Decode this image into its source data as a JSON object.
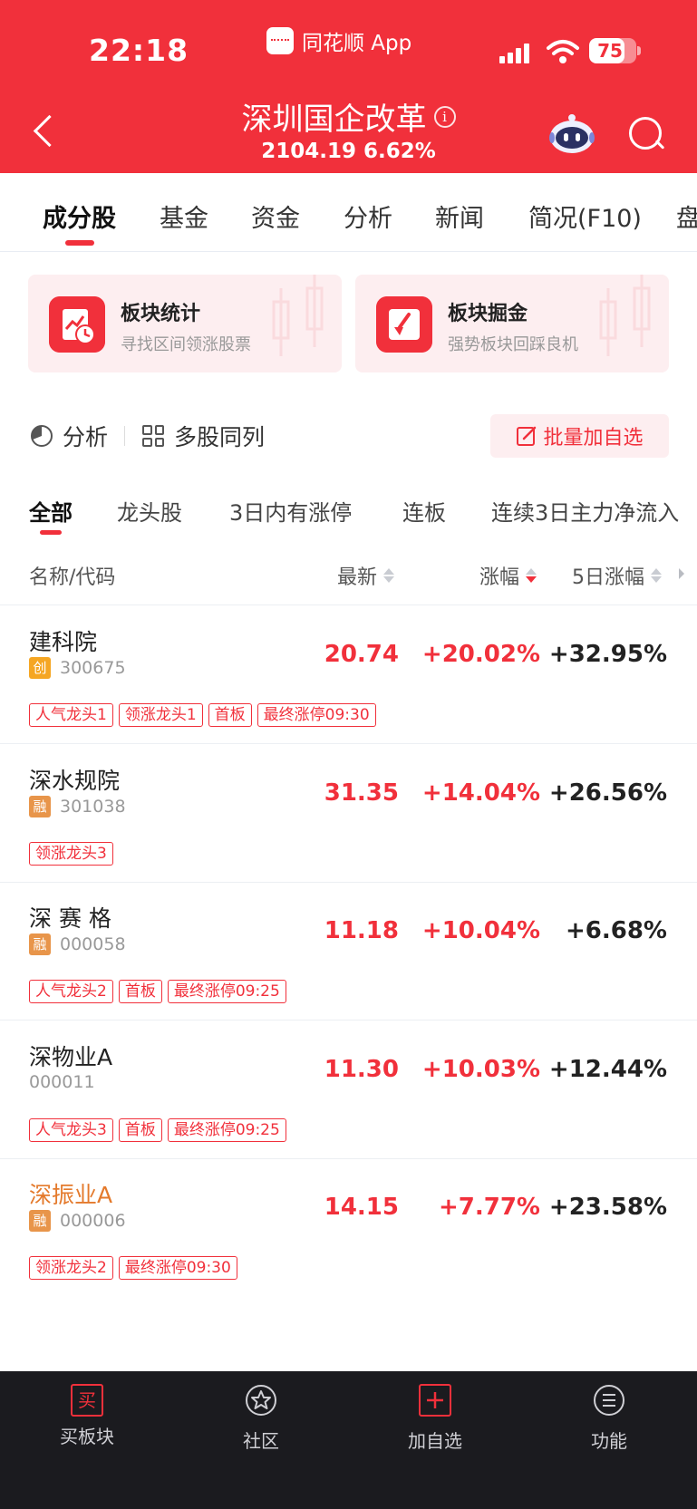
{
  "status": {
    "time": "22:18",
    "app_name": "同花顺 App",
    "battery": "75",
    "battery_level": 0.75
  },
  "header": {
    "title": "深圳国企改革",
    "index_value": "2104.19",
    "index_change": "6.62%"
  },
  "top_tabs": [
    "成分股",
    "基金",
    "资金",
    "分析",
    "新闻",
    "简况(F10)",
    "盘"
  ],
  "cards": [
    {
      "title": "板块统计",
      "subtitle": "寻找区间领涨股票"
    },
    {
      "title": "板块掘金",
      "subtitle": "强势板块回踩良机"
    }
  ],
  "actions": {
    "analysis": "分析",
    "multi": "多股同列",
    "batch_add": "批量加自选"
  },
  "filter_tabs": [
    "全部",
    "龙头股",
    "3日内有涨停",
    "连板",
    "连续3日主力净流入"
  ],
  "columns": {
    "name": "名称/代码",
    "latest": "最新",
    "change": "涨幅",
    "change5": "5日涨幅"
  },
  "stocks": [
    {
      "name": "建科院",
      "mark": "创",
      "code": "300675",
      "price": "20.74",
      "change": "+20.02%",
      "change5": "+32.95%",
      "tags": [
        "人气龙头1",
        "领涨龙头1",
        "首板",
        "最终涨停09:30"
      ]
    },
    {
      "name": "深水规院",
      "mark": "融",
      "code": "301038",
      "price": "31.35",
      "change": "+14.04%",
      "change5": "+26.56%",
      "tags": [
        "领涨龙头3"
      ]
    },
    {
      "name": "深 赛 格",
      "mark": "融",
      "code": "000058",
      "price": "11.18",
      "change": "+10.04%",
      "change5": "+6.68%",
      "tags": [
        "人气龙头2",
        "首板",
        "最终涨停09:25"
      ]
    },
    {
      "name": "深物业A",
      "mark": "",
      "code": "000011",
      "price": "11.30",
      "change": "+10.03%",
      "change5": "+12.44%",
      "tags": [
        "人气龙头3",
        "首板",
        "最终涨停09:25"
      ]
    },
    {
      "name": "深振业A",
      "mark": "融",
      "code": "000006",
      "price": "14.15",
      "change": "+7.77%",
      "change5": "+23.58%",
      "tags": [
        "领涨龙头2",
        "最终涨停09:30"
      ]
    }
  ],
  "bottom_nav": [
    {
      "label": "买板块",
      "icon_text": "买"
    },
    {
      "label": "社区"
    },
    {
      "label": "加自选"
    },
    {
      "label": "功能"
    }
  ],
  "colors": {
    "brand_red": "#f1303b",
    "bottom_bar": "#1b1b1f",
    "highlight_orange": "#e47a2c"
  }
}
